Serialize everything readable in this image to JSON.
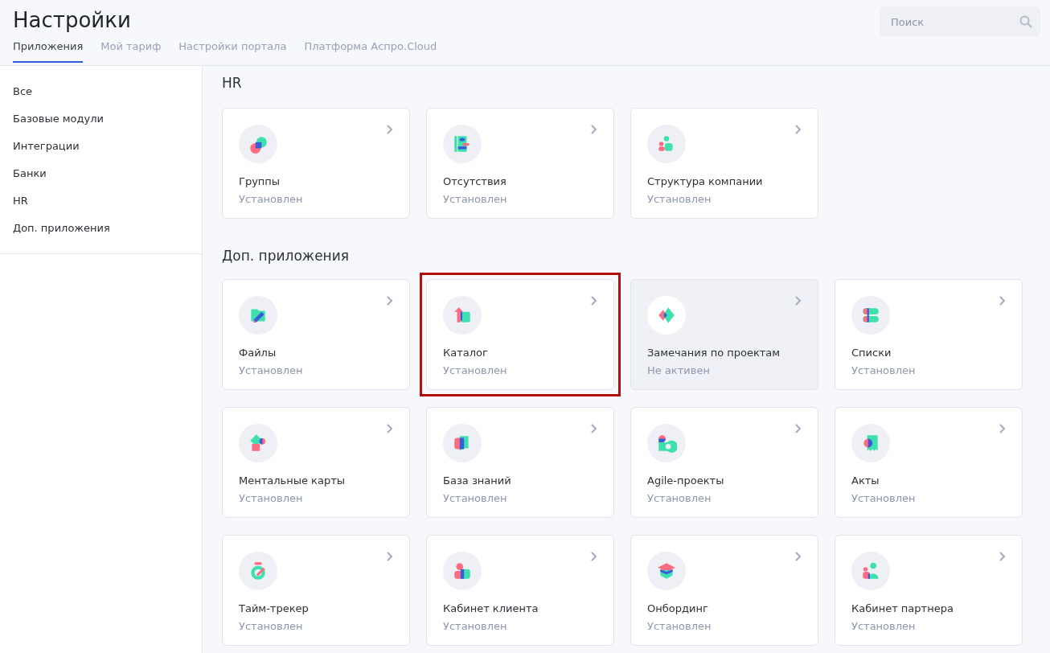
{
  "page": {
    "title": "Настройки"
  },
  "tabs": [
    {
      "label": "Приложения",
      "selected": true
    },
    {
      "label": "Мой тариф",
      "selected": false
    },
    {
      "label": "Настройки портала",
      "selected": false
    },
    {
      "label": "Платформа Аспро.Cloud",
      "selected": false
    }
  ],
  "search": {
    "placeholder": "Поиск"
  },
  "sidebar": {
    "items": [
      "Все",
      "Базовые модули",
      "Интеграции",
      "Банки",
      "HR",
      "Доп. приложения"
    ]
  },
  "sections": [
    {
      "title": "HR",
      "cards": [
        {
          "name": "Группы",
          "status": "Установлен",
          "active": true,
          "highlighted": false
        },
        {
          "name": "Отсутствия",
          "status": "Установлен",
          "active": true,
          "highlighted": false
        },
        {
          "name": "Структура компании",
          "status": "Установлен",
          "active": true,
          "highlighted": false
        }
      ]
    },
    {
      "title": "Доп. приложения",
      "cards": [
        {
          "name": "Файлы",
          "status": "Установлен",
          "active": true,
          "highlighted": false
        },
        {
          "name": "Каталог",
          "status": "Установлен",
          "active": true,
          "highlighted": true
        },
        {
          "name": "Замечания по проектам",
          "status": "Не активен",
          "active": false,
          "highlighted": false
        },
        {
          "name": "Списки",
          "status": "Установлен",
          "active": true,
          "highlighted": false
        },
        {
          "name": "Ментальные карты",
          "status": "Установлен",
          "active": true,
          "highlighted": false
        },
        {
          "name": "База знаний",
          "status": "Установлен",
          "active": true,
          "highlighted": false
        },
        {
          "name": "Agile-проекты",
          "status": "Установлен",
          "active": true,
          "highlighted": false
        },
        {
          "name": "Акты",
          "status": "Установлен",
          "active": true,
          "highlighted": false
        },
        {
          "name": "Тайм-трекер",
          "status": "Установлен",
          "active": true,
          "highlighted": false
        },
        {
          "name": "Кабинет клиента",
          "status": "Установлен",
          "active": true,
          "highlighted": false
        },
        {
          "name": "Онбординг",
          "status": "Установлен",
          "active": true,
          "highlighted": false
        },
        {
          "name": "Кабинет партнера",
          "status": "Установлен",
          "active": true,
          "highlighted": false
        }
      ]
    }
  ]
}
